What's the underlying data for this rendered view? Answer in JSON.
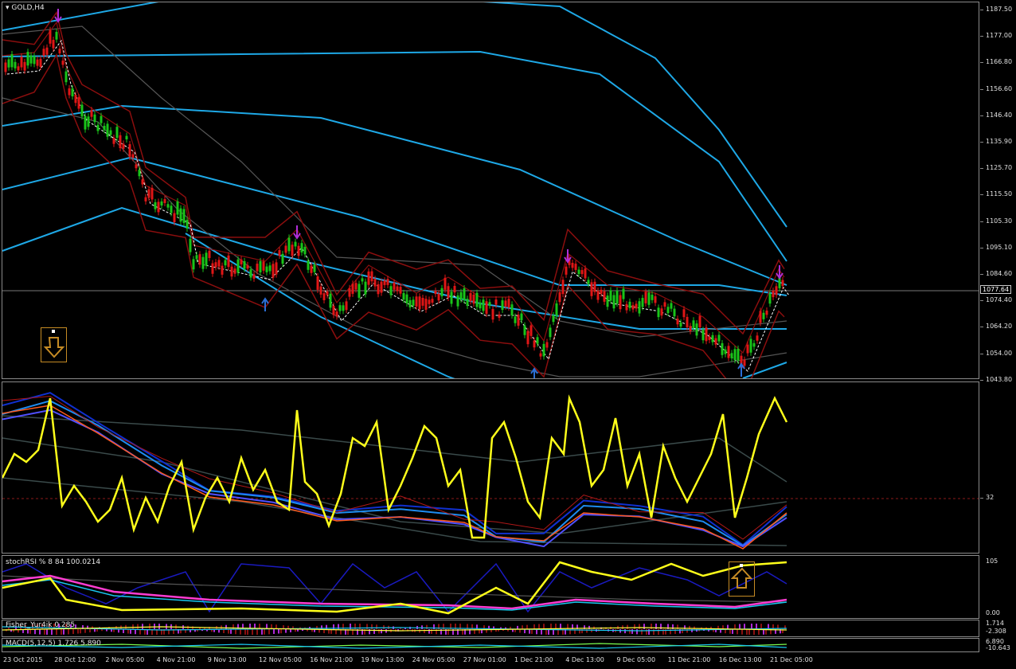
{
  "symbol_label": "GOLD,H4",
  "current_price": "1077.64",
  "price_scale": [
    "1187.50",
    "1177.00",
    "1166.80",
    "1156.60",
    "1146.40",
    "1135.90",
    "1125.70",
    "1115.50",
    "1105.30",
    "1095.10",
    "1084.60",
    "1074.40",
    "1064.20",
    "1054.00",
    "1043.80"
  ],
  "osc1_scale": [
    "32"
  ],
  "osc2_label": "stochRSI % 8 84 100.0214",
  "osc2_scale": [
    "105",
    "0.00"
  ],
  "osc3_label": "Fisher_Yur4ik 0.285",
  "osc3_scale": [
    "1.714",
    "-2.308"
  ],
  "osc4_label": "MACD(5,12,5) 1.726 5.890",
  "osc4_scale": [
    "6.890",
    "-10.643"
  ],
  "time_axis": [
    "23 Oct 2015",
    "28 Oct 12:00",
    "2 Nov 05:00",
    "4 Nov 21:00",
    "9 Nov 13:00",
    "12 Nov 05:00",
    "16 Nov 21:00",
    "19 Nov 13:00",
    "24 Nov 05:00",
    "27 Nov 01:00",
    "1 Dec 21:00",
    "4 Dec 13:00",
    "9 Dec 05:00",
    "11 Dec 21:00",
    "16 Dec 13:00",
    "21 Dec 05:00"
  ],
  "colors": {
    "bull": "#19c419",
    "bear": "#e01616",
    "band_blue": "#1ea8e6",
    "band_red": "#8b0e0e",
    "yellow": "#ffff1a",
    "magenta": "#ff3cd2",
    "arrow": "#c58b24"
  },
  "icons": {
    "sell_signal": "arrow-down-icon",
    "buy_signal": "arrow-up-icon"
  }
}
